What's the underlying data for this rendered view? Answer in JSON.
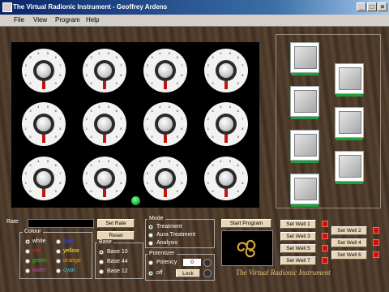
{
  "window": {
    "title": "The Virtual Radionic Instrument - Geoffrey Ardens"
  },
  "menu": [
    "File",
    "View",
    "Program",
    "Help"
  ],
  "dials": {
    "tick_labels": [
      "0",
      "1",
      "2",
      "3",
      "4",
      "5",
      "6",
      "7",
      "8",
      "9"
    ],
    "count": 12
  },
  "wells": {
    "label": "wells"
  },
  "controls": {
    "rate_label": "Rate",
    "set_rate_label": "Set Rate",
    "reset_label": "Reset",
    "colour": {
      "title": "Colour",
      "options": [
        {
          "label": "white",
          "color": "#ffffff",
          "selected": true
        },
        {
          "label": "red",
          "color": "#ff2020",
          "selected": false
        },
        {
          "label": "green",
          "color": "#22cc22",
          "selected": false
        },
        {
          "label": "violet",
          "color": "#cc44cc",
          "selected": false
        },
        {
          "label": "blue",
          "color": "#3344ff",
          "selected": false
        },
        {
          "label": "yellow",
          "color": "#ffee44",
          "selected": false
        },
        {
          "label": "orange",
          "color": "#ff9900",
          "selected": false
        },
        {
          "label": "cyan",
          "color": "#22dddd",
          "selected": false
        }
      ]
    },
    "base": {
      "title": "Base",
      "options": [
        {
          "label": "Base 10",
          "selected": true
        },
        {
          "label": "Base 44",
          "selected": false
        },
        {
          "label": "Base 12",
          "selected": false
        }
      ]
    },
    "mode": {
      "title": "Mode",
      "options": [
        {
          "label": "Treatment",
          "selected": true
        },
        {
          "label": "Aura Treatment",
          "selected": false
        },
        {
          "label": "Analysis",
          "selected": false
        }
      ]
    },
    "potentizer": {
      "title": "Potentizer",
      "options": [
        {
          "label": "Potency",
          "selected": false
        },
        {
          "label": "off",
          "selected": true
        }
      ],
      "potency_value": "0",
      "lock_label": "Lock"
    },
    "start_program_label": "Start Program",
    "set_well_buttons": [
      "Set Well 1",
      "Set Well 2",
      "Set Well 3",
      "Set Well 4",
      "Set Well 5",
      "Set Well 6",
      "Set Well 7"
    ],
    "led_color": "#c8120c",
    "accent_green": "#11a63a"
  },
  "footer": {
    "title": "The Virtual Radionic Instrument"
  }
}
